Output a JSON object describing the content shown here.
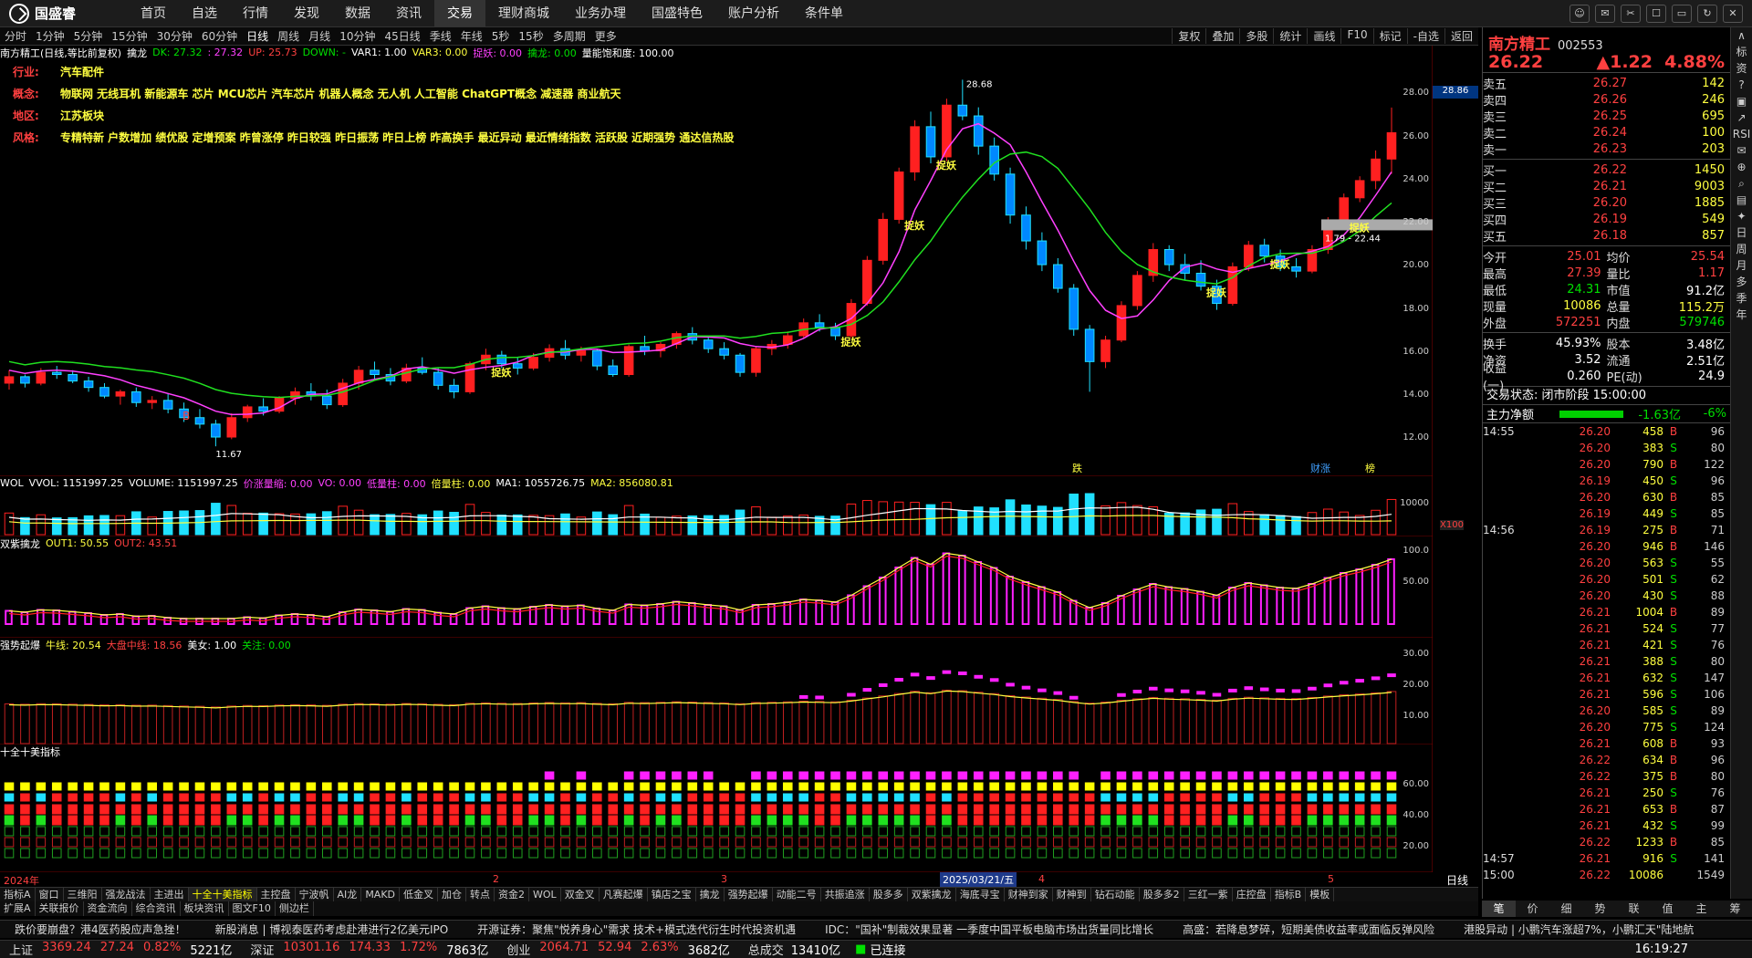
{
  "app": {
    "logo": "国盛睿"
  },
  "nav": [
    "首页",
    "自选",
    "行情",
    "发现",
    "数据",
    "资讯",
    "交易",
    "理财商城",
    "业务办理",
    "国盛特色",
    "账户分析",
    "条件单"
  ],
  "nav_active": 6,
  "winbtns": [
    "☺",
    "✉",
    "✂",
    "☐",
    "▭",
    "↻",
    "✕"
  ],
  "periods": [
    "分时",
    "1分钟",
    "5分钟",
    "15分钟",
    "30分钟",
    "60分钟",
    "日线",
    "周线",
    "月线",
    "10分钟",
    "45日线",
    "季线",
    "年线",
    "5秒",
    "15秒",
    "多周期",
    "更多"
  ],
  "period_active": 6,
  "tools": [
    "复权",
    "叠加",
    "多股",
    "统计",
    "画线",
    "F10",
    "标记",
    "-自选",
    "返回"
  ],
  "main_header": {
    "title": "南方精工(日线,等比前复权)",
    "ind": "擒龙",
    "dk": "DK: 27.32",
    "dk2": ": 27.32",
    "up": "UP: 25.73",
    "down": "DOWN: -",
    "var1": "VAR1: 1.00",
    "var3": "VAR3: 0.00",
    "zhuoyao": "捉妖: 0.00",
    "qinlong": "擒龙: 0.00",
    "lnbh": "量能饱和度: 100.00"
  },
  "info_lines": [
    {
      "k": "行业:",
      "v": "汽车配件"
    },
    {
      "k": "概念:",
      "v": "物联网 无线耳机 新能源车 芯片 MCU芯片 汽车芯片 机器人概念 无人机 人工智能 ChatGPT概念 减速器 商业航天"
    },
    {
      "k": "地区:",
      "v": "江苏板块"
    },
    {
      "k": "风格:",
      "v": "专精特新 户数增加 绩优股 定增预案 昨曾涨停 昨日较强 昨日振荡 昨日上榜 昨高换手 最近异动 最近情绪指数 活跃股 近期强势 通达信热股"
    }
  ],
  "main_y": [
    "28.00",
    "26.00",
    "24.00",
    "22.00",
    "20.00",
    "18.00",
    "16.00",
    "14.00",
    "12.00"
  ],
  "price_tag": "28.86",
  "annotations": {
    "high": "28.68",
    "low": "11.67",
    "range": "1.79 - 22.44",
    "zy": "捉妖",
    "die": "跌",
    "caizhang": "财涨",
    "bang": "榜",
    "b": "B"
  },
  "vol_header": {
    "name": "WOL",
    "vvol": "VVOL: 1151997.25",
    "volume": "VOLUME: 1151997.25",
    "jz": "价涨量缩: 0.00",
    "vo": "VO: 0.00",
    "dl": "低量柱: 0.00",
    "bl": "倍量柱: 0.00",
    "ma1": "MA1: 1055726.75",
    "ma2": "MA2: 856080.81"
  },
  "vol_y": [
    "10000"
  ],
  "vol_unit": "X100",
  "sz_header": {
    "name": "双紫擒龙",
    "out1": "OUT1: 50.55",
    "out2": "OUT2: 43.51"
  },
  "sz_y": [
    "100.0",
    "50.00"
  ],
  "qs_header": {
    "name": "强势起爆",
    "nx": "牛线: 20.54",
    "dp": "大盘中线: 18.56",
    "mn": "美女: 1.00",
    "gz": "关注: 0.00"
  },
  "qs_y": [
    "30.00",
    "20.00",
    "10.00"
  ],
  "sq_header": {
    "name": "十全十美指标"
  },
  "sq_y": [
    "60.00",
    "40.00",
    "20.00"
  ],
  "dates": {
    "d2024": "2024年",
    "m2": "2",
    "m3": "3",
    "sel": "2025/03/21/五",
    "m4": "4",
    "m5": "5",
    "period": "日线"
  },
  "indtabs": [
    "指标A",
    "窗口",
    "三维阳",
    "强龙战法",
    "主进出",
    "十全十美指标",
    "主控盘",
    "宁波帆",
    "AI龙",
    "MAKD",
    "低金叉",
    "加仓",
    "转点",
    "资金2",
    "WOL",
    "双金叉",
    "凡赛起爆",
    "镇店之宝",
    "擒龙",
    "强势起爆",
    "动能二号",
    "共振追涨",
    "股多多",
    "双紫擒龙",
    "海底寻宝",
    "财神到家",
    "财神到",
    "钻石动能",
    "股多多2",
    "三红一紫",
    "庄控盘",
    "指标B",
    "模板"
  ],
  "indtab_active": 5,
  "infotabs": [
    "扩展A",
    "关联报价",
    "资金流向",
    "综合资讯",
    "板块资讯",
    "图文F10",
    "侧边栏"
  ],
  "stock": {
    "name": "南方精工",
    "code": "002553",
    "price": "26.22",
    "chg": "▲1.22",
    "pct": "4.88%"
  },
  "asks": [
    {
      "k": "卖五",
      "p": "26.27",
      "v": "142"
    },
    {
      "k": "卖四",
      "p": "26.26",
      "v": "246"
    },
    {
      "k": "卖三",
      "p": "26.25",
      "v": "695"
    },
    {
      "k": "卖二",
      "p": "26.24",
      "v": "100"
    },
    {
      "k": "卖一",
      "p": "26.23",
      "v": "203"
    }
  ],
  "bids": [
    {
      "k": "买一",
      "p": "26.22",
      "v": "1450"
    },
    {
      "k": "买二",
      "p": "26.21",
      "v": "9003"
    },
    {
      "k": "买三",
      "p": "26.20",
      "v": "1885"
    },
    {
      "k": "买四",
      "p": "26.19",
      "v": "549"
    },
    {
      "k": "买五",
      "p": "26.18",
      "v": "857"
    }
  ],
  "stats": [
    {
      "k": "今开",
      "v": "25.01",
      "c": "red"
    },
    {
      "k": "均价",
      "v": "25.54",
      "c": "red"
    },
    {
      "k": "最高",
      "v": "27.39",
      "c": "red"
    },
    {
      "k": "量比",
      "v": "1.17",
      "c": "red"
    },
    {
      "k": "最低",
      "v": "24.31",
      "c": "green"
    },
    {
      "k": "市值",
      "v": "91.2亿",
      "c": "white"
    },
    {
      "k": "现量",
      "v": "10086",
      "c": "yellow"
    },
    {
      "k": "总量",
      "v": "115.2万",
      "c": "yellow"
    },
    {
      "k": "外盘",
      "v": "572251",
      "c": "red"
    },
    {
      "k": "内盘",
      "v": "579746",
      "c": "green"
    }
  ],
  "stats2": [
    {
      "k": "换手",
      "v": "45.93%",
      "c": "white"
    },
    {
      "k": "股本",
      "v": "3.48亿",
      "c": "white"
    },
    {
      "k": "净资",
      "v": "3.52",
      "c": "white"
    },
    {
      "k": "流通",
      "v": "2.51亿",
      "c": "white"
    },
    {
      "k": "收益(一)",
      "v": "0.260",
      "c": "white"
    },
    {
      "k": "PE(动)",
      "v": "24.9",
      "c": "white"
    }
  ],
  "trade_status": "交易状态: 闭市阶段 15:00:00",
  "net_flow": {
    "k": "主力净额",
    "v": "-1.63亿",
    "p": "-6%"
  },
  "ticks": [
    {
      "t": "14:55",
      "p": "26.20",
      "v": "458",
      "bs": "B",
      "c": "96"
    },
    {
      "t": "",
      "p": "26.20",
      "v": "383",
      "bs": "S",
      "c": "80"
    },
    {
      "t": "",
      "p": "26.20",
      "v": "790",
      "bs": "B",
      "c": "122"
    },
    {
      "t": "",
      "p": "26.19",
      "v": "450",
      "bs": "S",
      "c": "96"
    },
    {
      "t": "",
      "p": "26.20",
      "v": "630",
      "bs": "B",
      "c": "85"
    },
    {
      "t": "",
      "p": "26.19",
      "v": "449",
      "bs": "S",
      "c": "85"
    },
    {
      "t": "14:56",
      "p": "26.19",
      "v": "275",
      "bs": "B",
      "c": "71"
    },
    {
      "t": "",
      "p": "26.20",
      "v": "946",
      "bs": "B",
      "c": "146"
    },
    {
      "t": "",
      "p": "26.20",
      "v": "563",
      "bs": "S",
      "c": "55"
    },
    {
      "t": "",
      "p": "26.20",
      "v": "501",
      "bs": "S",
      "c": "62"
    },
    {
      "t": "",
      "p": "26.20",
      "v": "430",
      "bs": "S",
      "c": "88"
    },
    {
      "t": "",
      "p": "26.21",
      "v": "1004",
      "bs": "B",
      "c": "89"
    },
    {
      "t": "",
      "p": "26.21",
      "v": "524",
      "bs": "S",
      "c": "77"
    },
    {
      "t": "",
      "p": "26.21",
      "v": "421",
      "bs": "S",
      "c": "76"
    },
    {
      "t": "",
      "p": "26.21",
      "v": "388",
      "bs": "S",
      "c": "80"
    },
    {
      "t": "",
      "p": "26.21",
      "v": "632",
      "bs": "S",
      "c": "147"
    },
    {
      "t": "",
      "p": "26.21",
      "v": "596",
      "bs": "S",
      "c": "106"
    },
    {
      "t": "",
      "p": "26.20",
      "v": "585",
      "bs": "S",
      "c": "89"
    },
    {
      "t": "",
      "p": "26.20",
      "v": "775",
      "bs": "S",
      "c": "124"
    },
    {
      "t": "",
      "p": "26.21",
      "v": "608",
      "bs": "B",
      "c": "93"
    },
    {
      "t": "",
      "p": "26.22",
      "v": "634",
      "bs": "B",
      "c": "96"
    },
    {
      "t": "",
      "p": "26.22",
      "v": "375",
      "bs": "B",
      "c": "80"
    },
    {
      "t": "",
      "p": "26.21",
      "v": "250",
      "bs": "S",
      "c": "76"
    },
    {
      "t": "",
      "p": "26.21",
      "v": "653",
      "bs": "B",
      "c": "87"
    },
    {
      "t": "",
      "p": "26.21",
      "v": "432",
      "bs": "S",
      "c": "99"
    },
    {
      "t": "",
      "p": "26.22",
      "v": "1233",
      "bs": "B",
      "c": "85"
    },
    {
      "t": "14:57",
      "p": "26.21",
      "v": "916",
      "bs": "S",
      "c": "141"
    },
    {
      "t": "15:00",
      "p": "26.22",
      "v": "10086",
      "bs": "",
      "c": "1549"
    }
  ],
  "qtabs": [
    "笔",
    "价",
    "细",
    "势",
    "联",
    "值",
    "主",
    "筹"
  ],
  "sidebar": [
    "∧",
    "标",
    "资",
    "?",
    "▣",
    "↗",
    "RSI",
    "✉",
    "⊕",
    "⌕",
    "▤",
    "✦",
    "日",
    "周",
    "月",
    "多",
    "季",
    "年"
  ],
  "news": [
    "跌价要崩盘？港4医药股应声急挫！",
    "新股消息 | 博视泰医药考虑赴港进行2亿美元IPO",
    "开源证券：聚焦\"悦养身心\"需求 技术+模式迭代衍生时代投资机遇",
    "IDC：\"国补\"制裁效果显著 一季度中国平板电脑市场出货量同比增长",
    "高盛：若降息梦碎，短期美债收益率或面临反弹风险",
    "港股异动 | 小鹏汽车涨超7%，小鹏汇天\"陆地航"
  ],
  "indices": [
    {
      "k": "上证",
      "v": "3369.24",
      "c": "27.24",
      "p": "0.82%",
      "a": "5221亿",
      "col": "red"
    },
    {
      "k": "深证",
      "v": "10301.16",
      "c": "174.33",
      "p": "1.72%",
      "a": "7863亿",
      "col": "red"
    },
    {
      "k": "创业",
      "v": "2064.71",
      "c": "52.94",
      "p": "2.63%",
      "a": "3682亿",
      "col": "red"
    }
  ],
  "total": {
    "k": "总成交",
    "v": "13410亿"
  },
  "conn": "已连接",
  "clock": "16:19:27",
  "chart_data": {
    "type": "candlestick",
    "title": "南方精工(日线,等比前复权)",
    "ylim": [
      11,
      29.5
    ],
    "candles": [
      [
        14.6,
        15.2,
        14.3,
        14.9
      ],
      [
        14.9,
        15.0,
        14.4,
        14.6
      ],
      [
        14.6,
        15.3,
        14.5,
        15.1
      ],
      [
        15.1,
        15.4,
        14.8,
        15.0
      ],
      [
        15.0,
        15.2,
        14.6,
        14.7
      ],
      [
        14.7,
        14.9,
        14.2,
        14.4
      ],
      [
        14.4,
        14.6,
        13.9,
        14.0
      ],
      [
        14.0,
        14.3,
        13.6,
        14.2
      ],
      [
        14.2,
        14.4,
        13.5,
        13.7
      ],
      [
        13.7,
        14.0,
        13.4,
        13.8
      ],
      [
        13.8,
        14.1,
        13.2,
        13.4
      ],
      [
        13.4,
        13.7,
        12.8,
        13.0
      ],
      [
        13.0,
        13.4,
        12.5,
        12.7
      ],
      [
        12.7,
        12.9,
        11.67,
        12.1
      ],
      [
        12.1,
        13.2,
        12.0,
        13.0
      ],
      [
        13.0,
        13.6,
        12.8,
        13.5
      ],
      [
        13.5,
        13.9,
        13.1,
        13.3
      ],
      [
        13.3,
        14.0,
        13.2,
        13.9
      ],
      [
        13.9,
        14.4,
        13.6,
        14.2
      ],
      [
        14.2,
        14.6,
        13.8,
        14.0
      ],
      [
        14.0,
        14.3,
        13.4,
        13.6
      ],
      [
        13.6,
        14.8,
        13.5,
        14.6
      ],
      [
        14.6,
        15.4,
        14.3,
        15.2
      ],
      [
        15.2,
        15.6,
        14.8,
        15.0
      ],
      [
        15.0,
        15.3,
        14.5,
        14.7
      ],
      [
        14.7,
        15.5,
        14.6,
        15.3
      ],
      [
        15.3,
        15.8,
        15.0,
        15.1
      ],
      [
        15.1,
        15.3,
        14.3,
        14.5
      ],
      [
        14.5,
        14.8,
        13.9,
        14.2
      ],
      [
        14.2,
        15.6,
        14.1,
        15.5
      ],
      [
        15.5,
        16.2,
        15.2,
        15.9
      ],
      [
        15.9,
        16.1,
        15.3,
        15.5
      ],
      [
        15.5,
        15.8,
        15.0,
        15.3
      ],
      [
        15.3,
        16.0,
        15.2,
        15.8
      ],
      [
        15.8,
        16.4,
        15.6,
        16.2
      ],
      [
        16.2,
        16.6,
        15.7,
        15.9
      ],
      [
        15.9,
        16.3,
        15.6,
        16.1
      ],
      [
        16.1,
        16.2,
        15.2,
        15.4
      ],
      [
        15.4,
        15.7,
        14.9,
        15.0
      ],
      [
        15.0,
        16.4,
        14.9,
        16.3
      ],
      [
        16.3,
        16.8,
        15.9,
        16.1
      ],
      [
        16.1,
        16.5,
        15.8,
        16.4
      ],
      [
        16.4,
        17.0,
        16.2,
        16.9
      ],
      [
        16.9,
        17.2,
        16.4,
        16.6
      ],
      [
        16.6,
        16.8,
        16.0,
        16.2
      ],
      [
        16.2,
        16.5,
        15.7,
        15.9
      ],
      [
        15.9,
        16.0,
        14.9,
        15.1
      ],
      [
        15.1,
        16.3,
        14.9,
        16.2
      ],
      [
        16.2,
        16.6,
        15.9,
        16.4
      ],
      [
        16.4,
        17.0,
        16.2,
        16.8
      ],
      [
        16.8,
        17.6,
        16.7,
        17.4
      ],
      [
        17.4,
        17.8,
        17.0,
        17.2
      ],
      [
        17.2,
        17.4,
        16.6,
        16.8
      ],
      [
        16.8,
        18.5,
        16.7,
        18.3
      ],
      [
        18.3,
        20.5,
        18.2,
        20.3
      ],
      [
        20.3,
        22.5,
        20.1,
        22.2
      ],
      [
        22.2,
        24.6,
        22.0,
        24.4
      ],
      [
        24.4,
        26.8,
        24.0,
        26.5
      ],
      [
        26.5,
        27.2,
        24.8,
        25.1
      ],
      [
        25.1,
        27.8,
        24.9,
        27.5
      ],
      [
        27.5,
        28.68,
        26.8,
        27.0
      ],
      [
        27.0,
        27.4,
        25.2,
        25.6
      ],
      [
        25.6,
        26.0,
        24.0,
        24.3
      ],
      [
        24.3,
        24.6,
        22.0,
        22.4
      ],
      [
        22.4,
        22.8,
        20.8,
        21.2
      ],
      [
        21.2,
        21.6,
        19.8,
        20.1
      ],
      [
        20.1,
        20.4,
        18.8,
        19.0
      ],
      [
        19.0,
        19.2,
        16.8,
        17.1
      ],
      [
        17.1,
        17.3,
        14.2,
        15.6
      ],
      [
        15.6,
        16.8,
        15.3,
        16.6
      ],
      [
        16.6,
        18.4,
        16.5,
        18.2
      ],
      [
        18.2,
        19.8,
        18.0,
        19.6
      ],
      [
        19.6,
        21.1,
        19.3,
        20.8
      ],
      [
        20.8,
        21.0,
        19.8,
        20.1
      ],
      [
        20.1,
        20.6,
        19.4,
        19.7
      ],
      [
        19.7,
        20.3,
        18.9,
        19.1
      ],
      [
        19.1,
        19.4,
        18.0,
        18.3
      ],
      [
        18.3,
        20.2,
        18.2,
        20.0
      ],
      [
        20.0,
        21.2,
        19.8,
        21.0
      ],
      [
        21.0,
        21.3,
        20.2,
        20.5
      ],
      [
        20.5,
        20.8,
        19.8,
        20.0
      ],
      [
        20.0,
        20.4,
        19.5,
        19.8
      ],
      [
        19.8,
        21.0,
        19.7,
        20.8
      ],
      [
        20.8,
        22.3,
        20.6,
        22.1
      ],
      [
        22.1,
        23.4,
        21.9,
        23.2
      ],
      [
        23.2,
        24.2,
        23.0,
        24.0
      ],
      [
        24.0,
        25.4,
        23.6,
        25.0
      ],
      [
        25.0,
        27.39,
        24.31,
        26.22
      ]
    ]
  }
}
